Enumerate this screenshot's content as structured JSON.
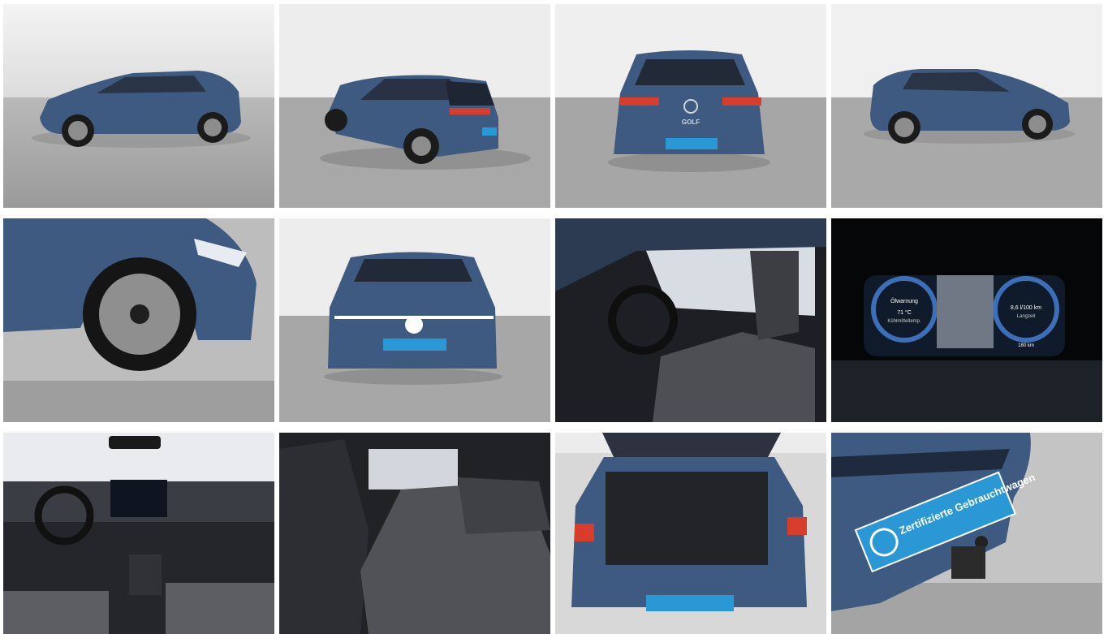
{
  "gallery": {
    "plate_label": "Zertifizierte Gebrauchtwagen",
    "cluster": {
      "left_label": "Ölwarnung",
      "left_temp": "71 °C",
      "left_sub": "Kühlmitteltemp.",
      "right_value": "8,6 l/100 km",
      "right_sub": "Langzeit",
      "range": "180 km"
    },
    "rear_badge": "GOLF"
  },
  "colors": {
    "car_blue": "#3f5a80",
    "plate_blue": "#2b98d6",
    "studio_floor": "#a9a9a9",
    "studio_wall": "#f2f2f2"
  }
}
